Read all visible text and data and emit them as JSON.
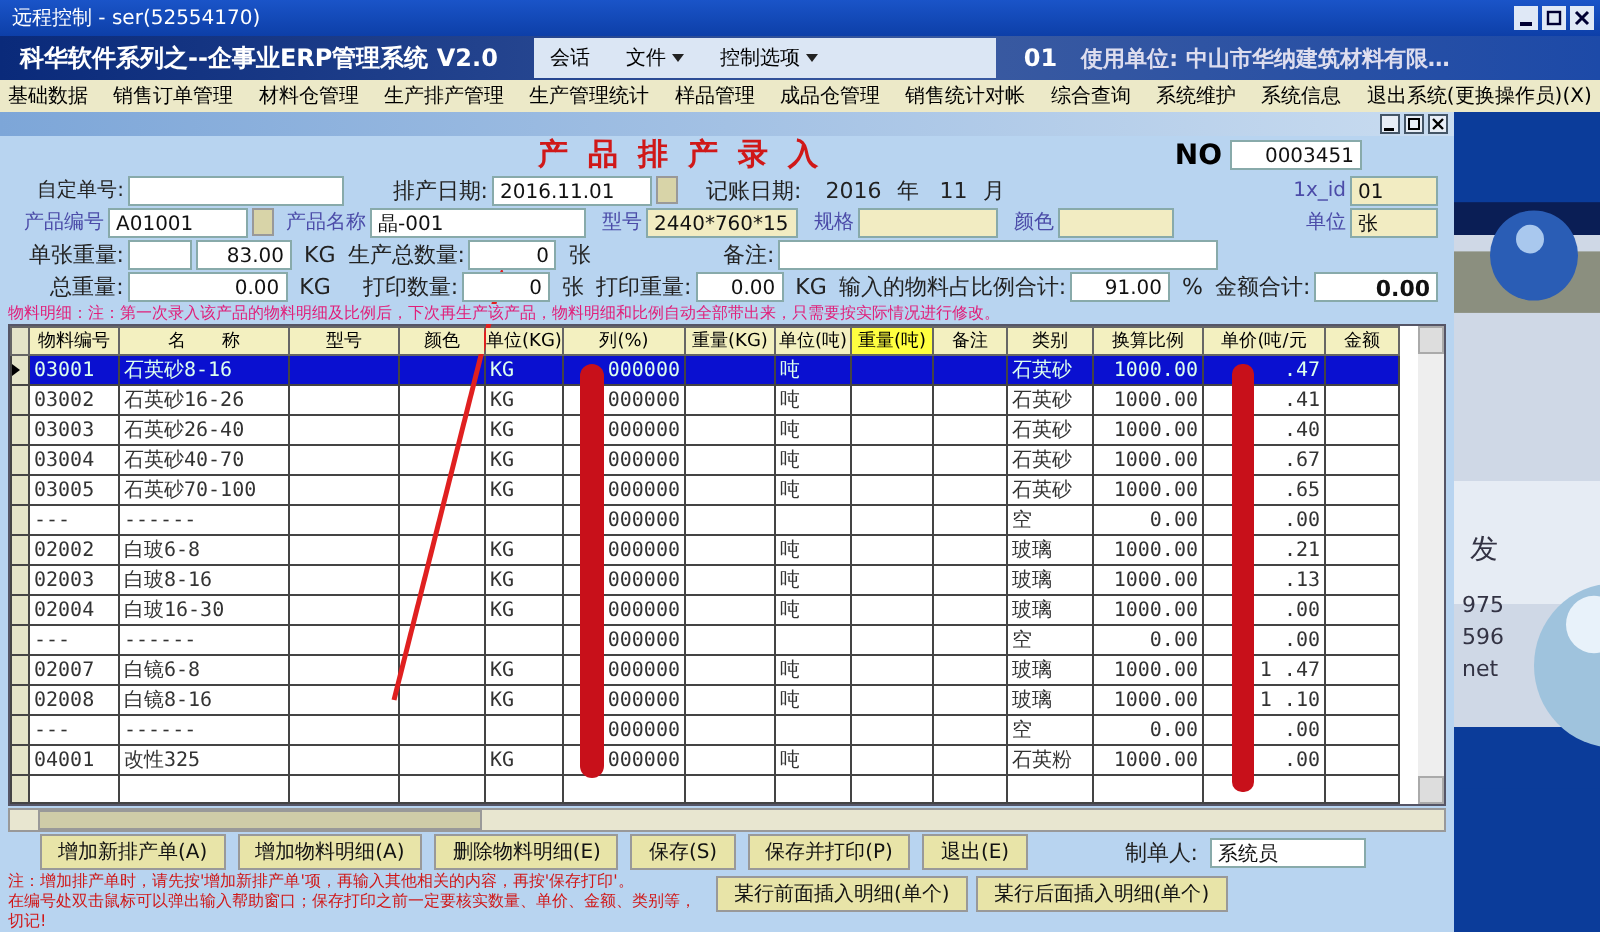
{
  "remote_window": {
    "title": "远程控制 - ser(52554170)"
  },
  "app_title": {
    "title": "科华软件系列之--企事业ERP管理系统 V2.0",
    "code": "01",
    "company": "使用单位: 中山市华纳建筑材料有限…"
  },
  "remote_toolbar": [
    {
      "label": "会话",
      "dropdown": false
    },
    {
      "label": "文件",
      "dropdown": true
    },
    {
      "label": "控制选项",
      "dropdown": true
    }
  ],
  "menu": [
    "基础数据",
    "销售订单管理",
    "材料仓管理",
    "生产排产管理",
    "生产管理统计",
    "样品管理",
    "成品仓管理",
    "销售统计对帐",
    "综合查询",
    "系统维护",
    "系统信息",
    "退出系统(更换操作员)(X)"
  ],
  "form": {
    "title": "产品排产录入",
    "no_label": "NO",
    "no_value": "0003451",
    "order_no": {
      "label": "自定单号:"
    },
    "plan_date": {
      "label": "排产日期:",
      "value": "2016.11.01"
    },
    "book_date": {
      "label": "记账日期:",
      "year": "2016",
      "year_unit": "年",
      "month": "11",
      "month_unit": "月"
    },
    "lx_id": {
      "label": "1x_id",
      "value": "01"
    },
    "product_code": {
      "label": "产品编号",
      "value": "A01001"
    },
    "product_name": {
      "label": "产品名称",
      "value": "晶-001"
    },
    "model": {
      "label": "型号",
      "value": "2440*760*15"
    },
    "spec": {
      "label": "规格"
    },
    "color": {
      "label": "颜色"
    },
    "unit": {
      "label": "单位",
      "value": "张"
    },
    "sheet_weight": {
      "label": "单张重量:",
      "value": "83.00",
      "unit": "KG"
    },
    "total_qty": {
      "label": "生产总数量:",
      "value": "0",
      "unit": "张"
    },
    "remark": {
      "label": "备注:"
    },
    "total_weight": {
      "label": "总重量:",
      "value": "0.00",
      "unit": "KG"
    },
    "print_qty": {
      "label": "打印数量:",
      "value": "0",
      "unit": "张"
    },
    "print_weight": {
      "label": "打印重量:",
      "value": "0.00",
      "unit": "KG"
    },
    "ratio_total": {
      "label": "输入的物料占比例合计:",
      "value": "91.00",
      "unit": "%"
    },
    "amount_total": {
      "label": "金额合计:",
      "value": "0.00"
    },
    "notice": "物料明细：注：第一次录入该产品的物料明细及比例后，下次再生产该产品，物料明细和比例自动全部带出来，只需要按实际情况进行修改。"
  },
  "table": {
    "columns": [
      "物料编号",
      "名　　称",
      "型号",
      "颜色",
      "单位(KG)",
      "列(%)",
      "重量(KG)",
      "单位(吨)",
      "重量(吨)",
      "备注",
      "类别",
      "换算比例",
      "单价(吨/元",
      "金额"
    ],
    "rows": [
      {
        "cells": [
          "03001",
          "石英砂8-16",
          "",
          "",
          "KG",
          "000000",
          "",
          "吨",
          "",
          "",
          "石英砂",
          "1000.00",
          ".47",
          ""
        ],
        "selected": true
      },
      {
        "cells": [
          "03002",
          "石英砂16-26",
          "",
          "",
          "KG",
          "000000",
          "",
          "吨",
          "",
          "",
          "石英砂",
          "1000.00",
          ".41",
          ""
        ],
        "selected": false
      },
      {
        "cells": [
          "03003",
          "石英砂26-40",
          "",
          "",
          "KG",
          "000000",
          "",
          "吨",
          "",
          "",
          "石英砂",
          "1000.00",
          ".40",
          ""
        ],
        "selected": false
      },
      {
        "cells": [
          "03004",
          "石英砂40-70",
          "",
          "",
          "KG",
          "000000",
          "",
          "吨",
          "",
          "",
          "石英砂",
          "1000.00",
          ".67",
          ""
        ],
        "selected": false
      },
      {
        "cells": [
          "03005",
          "石英砂70-100",
          "",
          "",
          "KG",
          "000000",
          "",
          "吨",
          "",
          "",
          "石英砂",
          "1000.00",
          ".65",
          ""
        ],
        "selected": false
      },
      {
        "cells": [
          "---",
          "------",
          "",
          "",
          "",
          "000000",
          "",
          "",
          "",
          "",
          "空",
          "0.00",
          ".00",
          ""
        ],
        "selected": false
      },
      {
        "cells": [
          "02002",
          "白玻6-8",
          "",
          "",
          "KG",
          "000000",
          "",
          "吨",
          "",
          "",
          "玻璃",
          "1000.00",
          ".21",
          ""
        ],
        "selected": false
      },
      {
        "cells": [
          "02003",
          "白玻8-16",
          "",
          "",
          "KG",
          "000000",
          "",
          "吨",
          "",
          "",
          "玻璃",
          "1000.00",
          ".13",
          ""
        ],
        "selected": false
      },
      {
        "cells": [
          "02004",
          "白玻16-30",
          "",
          "",
          "KG",
          "000000",
          "",
          "吨",
          "",
          "",
          "玻璃",
          "1000.00",
          ".00",
          ""
        ],
        "selected": false
      },
      {
        "cells": [
          "---",
          "------",
          "",
          "",
          "",
          "000000",
          "",
          "",
          "",
          "",
          "空",
          "0.00",
          ".00",
          ""
        ],
        "selected": false
      },
      {
        "cells": [
          "02007",
          "白镜6-8",
          "",
          "",
          "KG",
          "000000",
          "",
          "吨",
          "",
          "",
          "玻璃",
          "1000.00",
          "1 .47",
          ""
        ],
        "selected": false
      },
      {
        "cells": [
          "02008",
          "白镜8-16",
          "",
          "",
          "KG",
          "000000",
          "",
          "吨",
          "",
          "",
          "玻璃",
          "1000.00",
          "1 .10",
          ""
        ],
        "selected": false
      },
      {
        "cells": [
          "---",
          "------",
          "",
          "",
          "",
          "000000",
          "",
          "",
          "",
          "",
          "空",
          "0.00",
          ".00",
          ""
        ],
        "selected": false
      },
      {
        "cells": [
          "04001",
          "改性325",
          "",
          "",
          "KG",
          "000000",
          "",
          "吨",
          "",
          "",
          "石英粉",
          "1000.00",
          ".00",
          ""
        ],
        "selected": false
      }
    ]
  },
  "buttons": [
    "增加新排产单(A)",
    "增加物料明细(A)",
    "删除物料明细(E)",
    "保存(S)",
    "保存并打印(P)",
    "退出(E)"
  ],
  "maker": {
    "label": "制单人:",
    "value": "系统员"
  },
  "notes": [
    "注：增加排产单时，请先按'增加新排产单'项，再输入其他相关的内容，再按'保存打印'。",
    "在编号处双击鼠标可以弹出输入帮助窗口；保存打印之前一定要核实数量、单价、金额、类别等，切记!"
  ],
  "insert_buttons": [
    "某行前面插入明细(单个)",
    "某行后面插入明细(单个)"
  ],
  "desktop_fragments": [
    "发",
    "975",
    "596",
    "net"
  ]
}
